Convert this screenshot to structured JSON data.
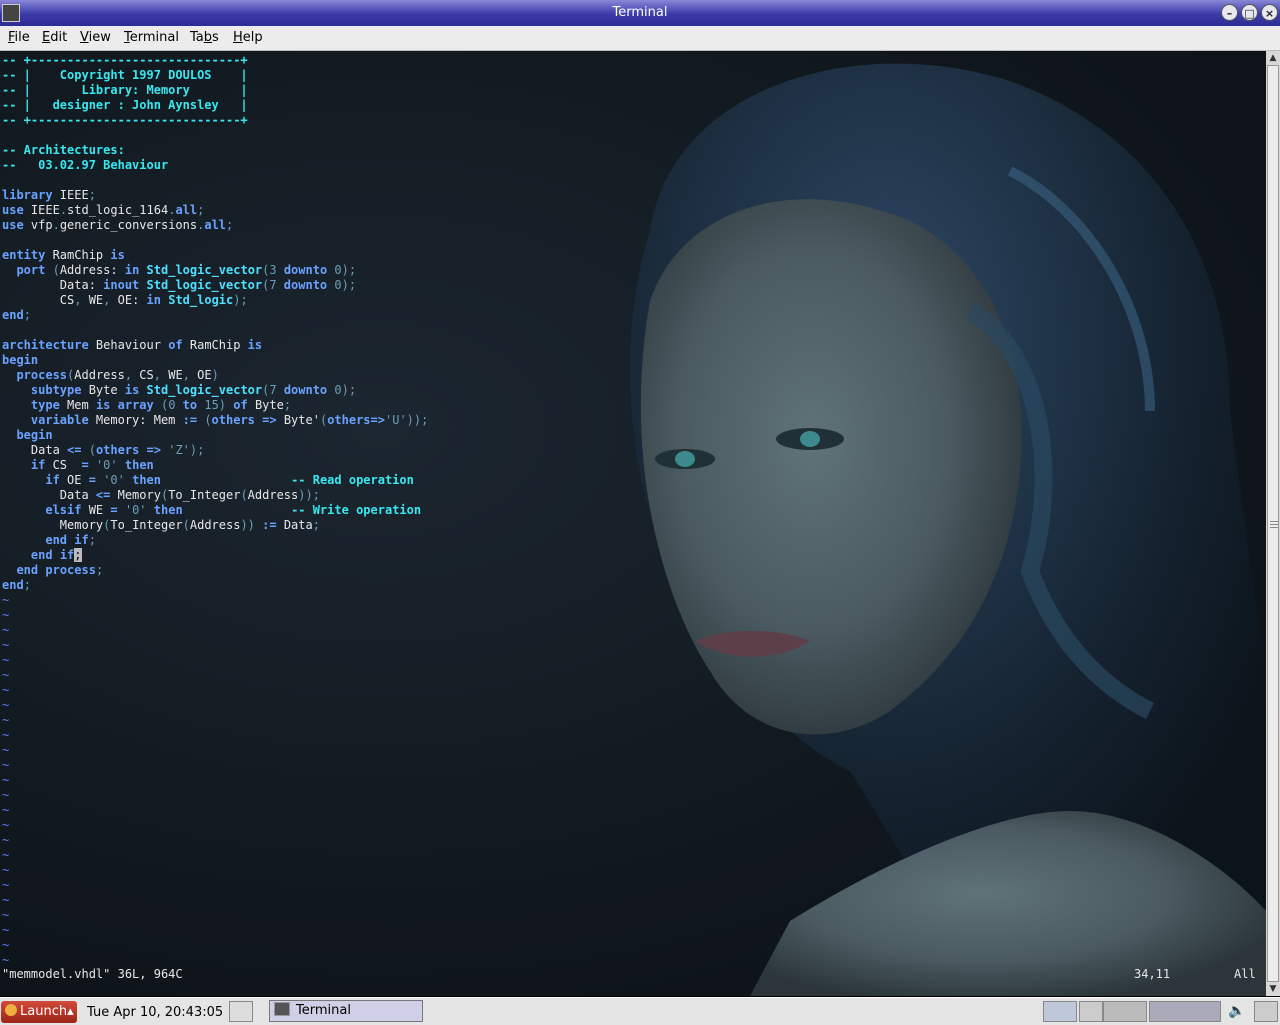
{
  "window": {
    "title": "Terminal"
  },
  "menu": [
    {
      "label": "File",
      "key": "F",
      "rest": "ile"
    },
    {
      "label": "Edit",
      "key": "E",
      "rest": "dit"
    },
    {
      "label": "View",
      "key": "V",
      "rest": "iew"
    },
    {
      "label": "Terminal",
      "key": "T",
      "rest": "erminal"
    },
    {
      "label": "Tabs",
      "key": "b",
      "pre": "Ta",
      "rest": "s"
    },
    {
      "label": "Help",
      "key": "H",
      "rest": "elp"
    }
  ],
  "editor": {
    "file_info": "\"memmodel.vhdl\" 36L, 964C",
    "cursor_pos": "34,11",
    "scroll_pos": "All",
    "tilde": "~",
    "tilde_lines": 25,
    "code_lines": [
      [
        [
          "cm",
          "-- +-----------------------------+"
        ]
      ],
      [
        [
          "cm",
          "-- |    Copyright 1997 DOULOS    |"
        ]
      ],
      [
        [
          "cm",
          "-- |       Library: Memory       |"
        ]
      ],
      [
        [
          "cm",
          "-- |   designer : John Aynsley   |"
        ]
      ],
      [
        [
          "cm",
          "-- +-----------------------------+"
        ]
      ],
      [
        [
          "tx",
          ""
        ]
      ],
      [
        [
          "cm",
          "-- Architectures:"
        ]
      ],
      [
        [
          "cm",
          "--   03.02.97 Behaviour"
        ]
      ],
      [
        [
          "tx",
          ""
        ]
      ],
      [
        [
          "kw",
          "library"
        ],
        [
          "tx",
          " IEEE"
        ],
        [
          "lit",
          ";"
        ]
      ],
      [
        [
          "kw",
          "use"
        ],
        [
          "tx",
          " IEEE"
        ],
        [
          "lit",
          "."
        ],
        [
          "tx",
          "std_logic_1164"
        ],
        [
          "lit",
          "."
        ],
        [
          "kw",
          "all"
        ],
        [
          "lit",
          ";"
        ]
      ],
      [
        [
          "kw",
          "use"
        ],
        [
          "tx",
          " vfp"
        ],
        [
          "lit",
          "."
        ],
        [
          "tx",
          "generic_conversions"
        ],
        [
          "lit",
          "."
        ],
        [
          "kw",
          "all"
        ],
        [
          "lit",
          ";"
        ]
      ],
      [
        [
          "tx",
          ""
        ]
      ],
      [
        [
          "kw",
          "entity"
        ],
        [
          "tx",
          " RamChip "
        ],
        [
          "kw",
          "is"
        ]
      ],
      [
        [
          "tx",
          "  "
        ],
        [
          "kw",
          "port"
        ],
        [
          "tx",
          " "
        ],
        [
          "lit",
          "("
        ],
        [
          "tx",
          "Address: "
        ],
        [
          "kw",
          "in"
        ],
        [
          "tx",
          " "
        ],
        [
          "ty",
          "Std_logic_vector"
        ],
        [
          "lit",
          "(3 "
        ],
        [
          "kw",
          "downto"
        ],
        [
          "lit",
          " 0);"
        ]
      ],
      [
        [
          "tx",
          "        Data: "
        ],
        [
          "kw",
          "inout"
        ],
        [
          "tx",
          " "
        ],
        [
          "ty",
          "Std_logic_vector"
        ],
        [
          "lit",
          "(7 "
        ],
        [
          "kw",
          "downto"
        ],
        [
          "lit",
          " 0);"
        ]
      ],
      [
        [
          "tx",
          "        CS"
        ],
        [
          "lit",
          ","
        ],
        [
          "tx",
          " WE"
        ],
        [
          "lit",
          ","
        ],
        [
          "tx",
          " OE: "
        ],
        [
          "kw",
          "in"
        ],
        [
          "tx",
          " "
        ],
        [
          "ty",
          "Std_logic"
        ],
        [
          "lit",
          ");"
        ]
      ],
      [
        [
          "kw",
          "end"
        ],
        [
          "lit",
          ";"
        ]
      ],
      [
        [
          "tx",
          ""
        ]
      ],
      [
        [
          "kw",
          "architecture"
        ],
        [
          "tx",
          " Behaviour "
        ],
        [
          "kw",
          "of"
        ],
        [
          "tx",
          " RamChip "
        ],
        [
          "kw",
          "is"
        ]
      ],
      [
        [
          "kw",
          "begin"
        ]
      ],
      [
        [
          "tx",
          "  "
        ],
        [
          "kw",
          "process"
        ],
        [
          "lit",
          "("
        ],
        [
          "tx",
          "Address"
        ],
        [
          "lit",
          ","
        ],
        [
          "tx",
          " CS"
        ],
        [
          "lit",
          ","
        ],
        [
          "tx",
          " WE"
        ],
        [
          "lit",
          ","
        ],
        [
          "tx",
          " OE"
        ],
        [
          "lit",
          ")"
        ]
      ],
      [
        [
          "tx",
          "    "
        ],
        [
          "kw",
          "subtype"
        ],
        [
          "tx",
          " Byte "
        ],
        [
          "kw",
          "is"
        ],
        [
          "tx",
          " "
        ],
        [
          "ty",
          "Std_logic_vector"
        ],
        [
          "lit",
          "(7 "
        ],
        [
          "kw",
          "downto"
        ],
        [
          "lit",
          " 0);"
        ]
      ],
      [
        [
          "tx",
          "    "
        ],
        [
          "kw",
          "type"
        ],
        [
          "tx",
          " Mem "
        ],
        [
          "kw",
          "is"
        ],
        [
          "tx",
          " "
        ],
        [
          "kw",
          "array"
        ],
        [
          "tx",
          " "
        ],
        [
          "lit",
          "(0 "
        ],
        [
          "kw",
          "to"
        ],
        [
          "lit",
          " 15)"
        ],
        [
          "tx",
          " "
        ],
        [
          "kw",
          "of"
        ],
        [
          "tx",
          " Byte"
        ],
        [
          "lit",
          ";"
        ]
      ],
      [
        [
          "tx",
          "    "
        ],
        [
          "kw",
          "variable"
        ],
        [
          "tx",
          " Memory: Mem "
        ],
        [
          "kw",
          ":="
        ],
        [
          "tx",
          " "
        ],
        [
          "lit",
          "("
        ],
        [
          "kw",
          "others"
        ],
        [
          "tx",
          " "
        ],
        [
          "kw",
          "=>"
        ],
        [
          "tx",
          " Byte'"
        ],
        [
          "lit",
          "("
        ],
        [
          "kw",
          "others"
        ],
        [
          "kw",
          "=>"
        ],
        [
          "lit",
          "'U'));"
        ]
      ],
      [
        [
          "tx",
          "  "
        ],
        [
          "kw",
          "begin"
        ]
      ],
      [
        [
          "tx",
          "    Data "
        ],
        [
          "kw",
          "<="
        ],
        [
          "tx",
          " "
        ],
        [
          "lit",
          "("
        ],
        [
          "kw",
          "others"
        ],
        [
          "tx",
          " "
        ],
        [
          "kw",
          "=>"
        ],
        [
          "tx",
          " "
        ],
        [
          "lit",
          "'Z');"
        ]
      ],
      [
        [
          "tx",
          "    "
        ],
        [
          "kw",
          "if"
        ],
        [
          "tx",
          " CS  "
        ],
        [
          "kw",
          "="
        ],
        [
          "tx",
          " "
        ],
        [
          "lit",
          "'0'"
        ],
        [
          "tx",
          " "
        ],
        [
          "kw",
          "then"
        ]
      ],
      [
        [
          "tx",
          "      "
        ],
        [
          "kw",
          "if"
        ],
        [
          "tx",
          " OE "
        ],
        [
          "kw",
          "="
        ],
        [
          "tx",
          " "
        ],
        [
          "lit",
          "'0'"
        ],
        [
          "tx",
          " "
        ],
        [
          "kw",
          "then"
        ],
        [
          "tx",
          "                  "
        ],
        [
          "cm",
          "-- Read operation"
        ]
      ],
      [
        [
          "tx",
          "        Data "
        ],
        [
          "kw",
          "<="
        ],
        [
          "tx",
          " Memory"
        ],
        [
          "lit",
          "("
        ],
        [
          "tx",
          "To_Integer"
        ],
        [
          "lit",
          "("
        ],
        [
          "tx",
          "Address"
        ],
        [
          "lit",
          "));"
        ]
      ],
      [
        [
          "tx",
          "      "
        ],
        [
          "kw",
          "elsif"
        ],
        [
          "tx",
          " WE "
        ],
        [
          "kw",
          "="
        ],
        [
          "tx",
          " "
        ],
        [
          "lit",
          "'0'"
        ],
        [
          "tx",
          " "
        ],
        [
          "kw",
          "then"
        ],
        [
          "tx",
          "               "
        ],
        [
          "cm",
          "-- Write operation"
        ]
      ],
      [
        [
          "tx",
          "        Memory"
        ],
        [
          "lit",
          "("
        ],
        [
          "tx",
          "To_Integer"
        ],
        [
          "lit",
          "("
        ],
        [
          "tx",
          "Address"
        ],
        [
          "lit",
          "))"
        ],
        [
          "tx",
          " "
        ],
        [
          "kw",
          ":="
        ],
        [
          "tx",
          " Data"
        ],
        [
          "lit",
          ";"
        ]
      ],
      [
        [
          "tx",
          "      "
        ],
        [
          "kw",
          "end"
        ],
        [
          "tx",
          " "
        ],
        [
          "kw",
          "if"
        ],
        [
          "lit",
          ";"
        ]
      ],
      [
        [
          "tx",
          "    "
        ],
        [
          "kw",
          "end"
        ],
        [
          "tx",
          " "
        ],
        [
          "kw",
          "if"
        ],
        [
          "cur",
          ";"
        ]
      ],
      [
        [
          "tx",
          "  "
        ],
        [
          "kw",
          "end"
        ],
        [
          "tx",
          " "
        ],
        [
          "kw",
          "process"
        ],
        [
          "lit",
          ";"
        ]
      ],
      [
        [
          "kw",
          "end"
        ],
        [
          "lit",
          ";"
        ]
      ]
    ]
  },
  "panel": {
    "launch_label": "Launch",
    "clock": "Tue Apr 10, 20:43:05",
    "task_label": "Terminal"
  },
  "colors": {
    "titlebar": "#3b3aa8",
    "comment": "#38e8f0",
    "keyword": "#6aa2ff",
    "tilde": "#5b7bff"
  }
}
